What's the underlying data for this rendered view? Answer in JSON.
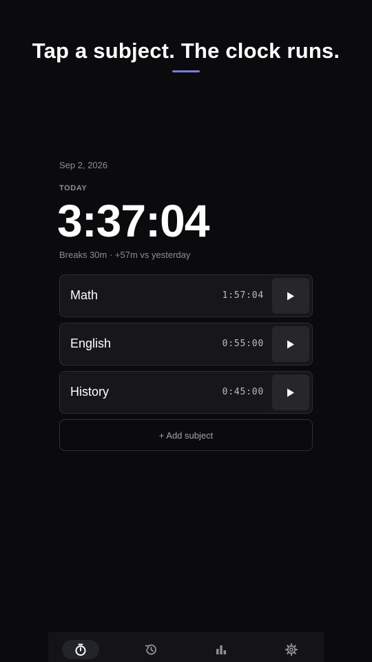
{
  "header": {
    "headline": "Tap a subject. The clock runs."
  },
  "summary": {
    "date": "Sep 2, 2026",
    "today_label": "TODAY",
    "total_time": "3:37:04",
    "details": "Breaks 30m · +57m vs yesterday"
  },
  "subjects": [
    {
      "name": "Math",
      "time": "1:57:04"
    },
    {
      "name": "English",
      "time": "0:55:00"
    },
    {
      "name": "History",
      "time": "0:45:00"
    }
  ],
  "add_subject_label": "+ Add subject",
  "nav": {
    "items": [
      {
        "icon": "stopwatch-icon",
        "active": true
      },
      {
        "icon": "history-icon",
        "active": false
      },
      {
        "icon": "bar-chart-icon",
        "active": false
      },
      {
        "icon": "gear-icon",
        "active": false
      }
    ]
  },
  "colors": {
    "background": "#0b0b0d",
    "accent": "#7b7fd6",
    "card": "#17171a",
    "muted_text": "#8d8d93"
  }
}
